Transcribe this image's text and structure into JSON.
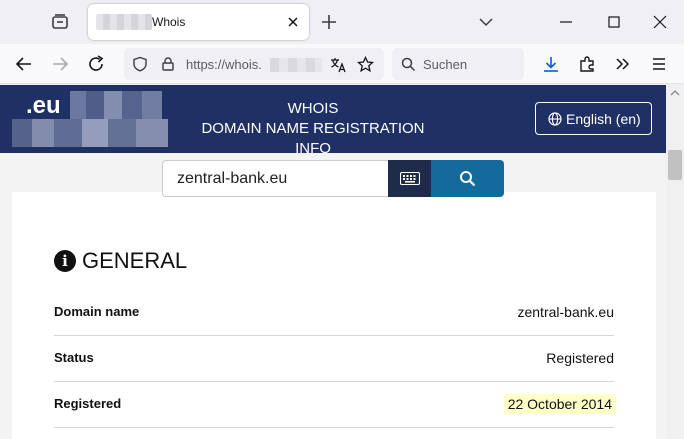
{
  "browser": {
    "tab_title": "Whois",
    "url": "https://whois.",
    "search_placeholder": "Suchen"
  },
  "site": {
    "logo_text": ".eu",
    "title_line1": "WHOIS",
    "title_line2": "DOMAIN NAME REGISTRATION INFO",
    "language_button": "English (en)"
  },
  "search": {
    "value": "zentral-bank.eu"
  },
  "general": {
    "heading": "GENERAL",
    "rows": [
      {
        "key": "Domain name",
        "value": "zentral-bank.eu"
      },
      {
        "key": "Status",
        "value": "Registered"
      },
      {
        "key": "Registered",
        "value": "22 October 2014"
      }
    ]
  },
  "colors": {
    "header_bg": "#1f3164",
    "search_button": "#136a9c",
    "keyboard_button": "#1f2b4a",
    "date_highlight": "#ffffc8"
  }
}
